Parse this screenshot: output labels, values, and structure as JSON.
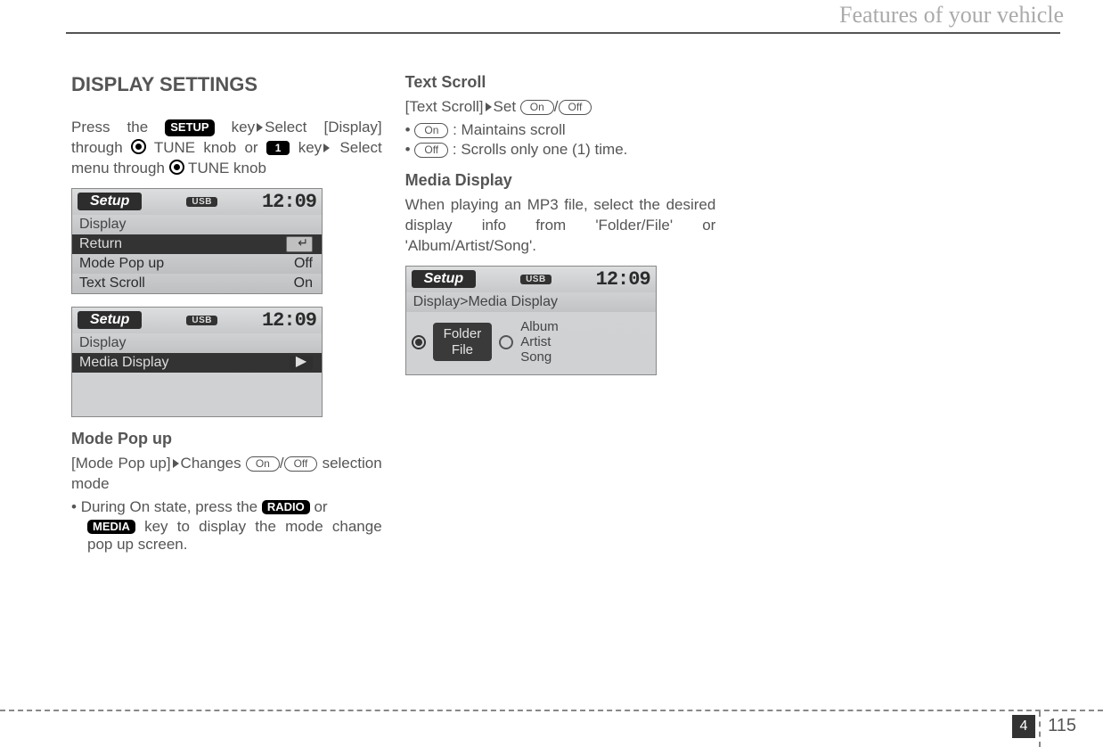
{
  "header": {
    "section_title": "Features of your vehicle"
  },
  "col1": {
    "h1": "DISPLAY SETTINGS",
    "intro": {
      "press_the": "Press the ",
      "setup_badge": "SETUP",
      "key": " key",
      "select_display": "Select [Display]",
      "through": "through ",
      "tune1": " TUNE knob or ",
      "one_badge": "1",
      "key2": " key",
      "select_menu": "Select menu through ",
      "tune2": " TUNE knob"
    },
    "lcd1": {
      "setup": "Setup",
      "usb": "USB",
      "clock": "12:09",
      "display": "Display",
      "return": "Return",
      "mode_popup": "Mode Pop up",
      "mode_popup_val": "Off",
      "text_scroll": "Text Scroll",
      "text_scroll_val": "On"
    },
    "lcd2": {
      "setup": "Setup",
      "usb": "USB",
      "clock": "12:09",
      "display": "Display",
      "media_display": "Media Display"
    },
    "mode_popup": {
      "heading": "Mode Pop up",
      "line1a": "[Mode Pop up]",
      "line1b": "Changes ",
      "on": "On",
      "off": "Off",
      "line1c": "selection mode",
      "bullet_a": "During On state, press the ",
      "radio_badge": "RADIO",
      "bullet_b": " or",
      "media_badge": "MEDIA",
      "bullet_c": " key to display the mode change pop up screen."
    }
  },
  "col2": {
    "text_scroll": {
      "heading": "Text Scroll",
      "line1a": "[Text Scroll]",
      "line1b": "Set ",
      "on": "On",
      "off": "Off",
      "b1_on": "On",
      "b1_text": " : Maintains scroll",
      "b2_off": "Off",
      "b2_text": " : Scrolls only one (1) time."
    },
    "media_display": {
      "heading": "Media Display",
      "para": "When playing an MP3 file, select the desired display info from 'Folder/File' or 'Album/Artist/Song'."
    },
    "lcd3": {
      "setup": "Setup",
      "usb": "USB",
      "clock": "12:09",
      "breadcrumb": "Display>Media Display",
      "choice1a": "Folder",
      "choice1b": "File",
      "choice2a": "Album",
      "choice2b": "Artist",
      "choice2c": "Song"
    }
  },
  "footer": {
    "chapter": "4",
    "page": "115"
  }
}
